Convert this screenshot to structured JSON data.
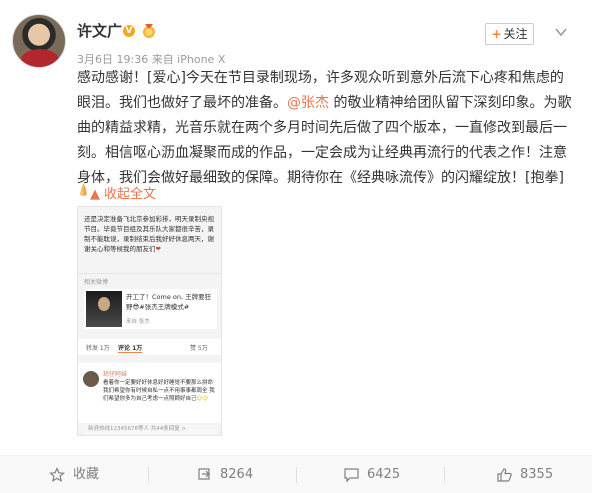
{
  "post": {
    "username": "许文广",
    "verified_badge": "V",
    "meta": "3月6日 19:36 来自 iPhone X",
    "follow_label": "关注",
    "content": {
      "p1": "感动感谢！[爱心]今天在节目录制现场，许多观众听到意外后流下心疼和焦虑的眼泪。我们也做好了最坏的准备。",
      "mention": "@张杰",
      "p2": " 的敬业精神给团队留下深刻印象。为歌曲的精益求精，光音乐就在两个多月时间先后做了四个版本，一直修改到最后一刻。相信呕心沥血凝聚而成的作品，一定会成为让经典再流行的代表之作！注意身体，我们会做好最细致的保障。期待你在《经典咏流传》的闪耀绽放！[抱拳]"
    },
    "expand_label": "收起全文"
  },
  "screenshot": {
    "text": "还是决定准备飞北京参加彩排，明天录制央视节目。毕竟节目组及其乐队大家都很辛苦，录制不能耽误，录制结束后我好好休息两天，谢谢关心和等候我的朋友们",
    "section_label": "相关微博",
    "card_text": "开工了！Come on, 王牌要狂野😎#张杰王牌模式#",
    "card_sub": "来自 张杰",
    "tabs": [
      "转发 1万",
      "评论 1万",
      "赞 5万"
    ],
    "comment_name": "琼仔阿妹",
    "comment_text": "看着你一定要好好休息好好睡觉不要那么拼命 我们希望你有时候自私一点不用事事都周全 我们希望你多为自己考虑一点照顾好自己",
    "footer": "新浪热线12345678等人  共44条回复 >"
  },
  "actions": {
    "favorite": "收藏",
    "repost": "8264",
    "comment": "6425",
    "like": "8355"
  },
  "colors": {
    "accent": "#eb7350",
    "follow_plus": "#ff8140",
    "verified": "#f4a623",
    "muted": "#808080"
  }
}
